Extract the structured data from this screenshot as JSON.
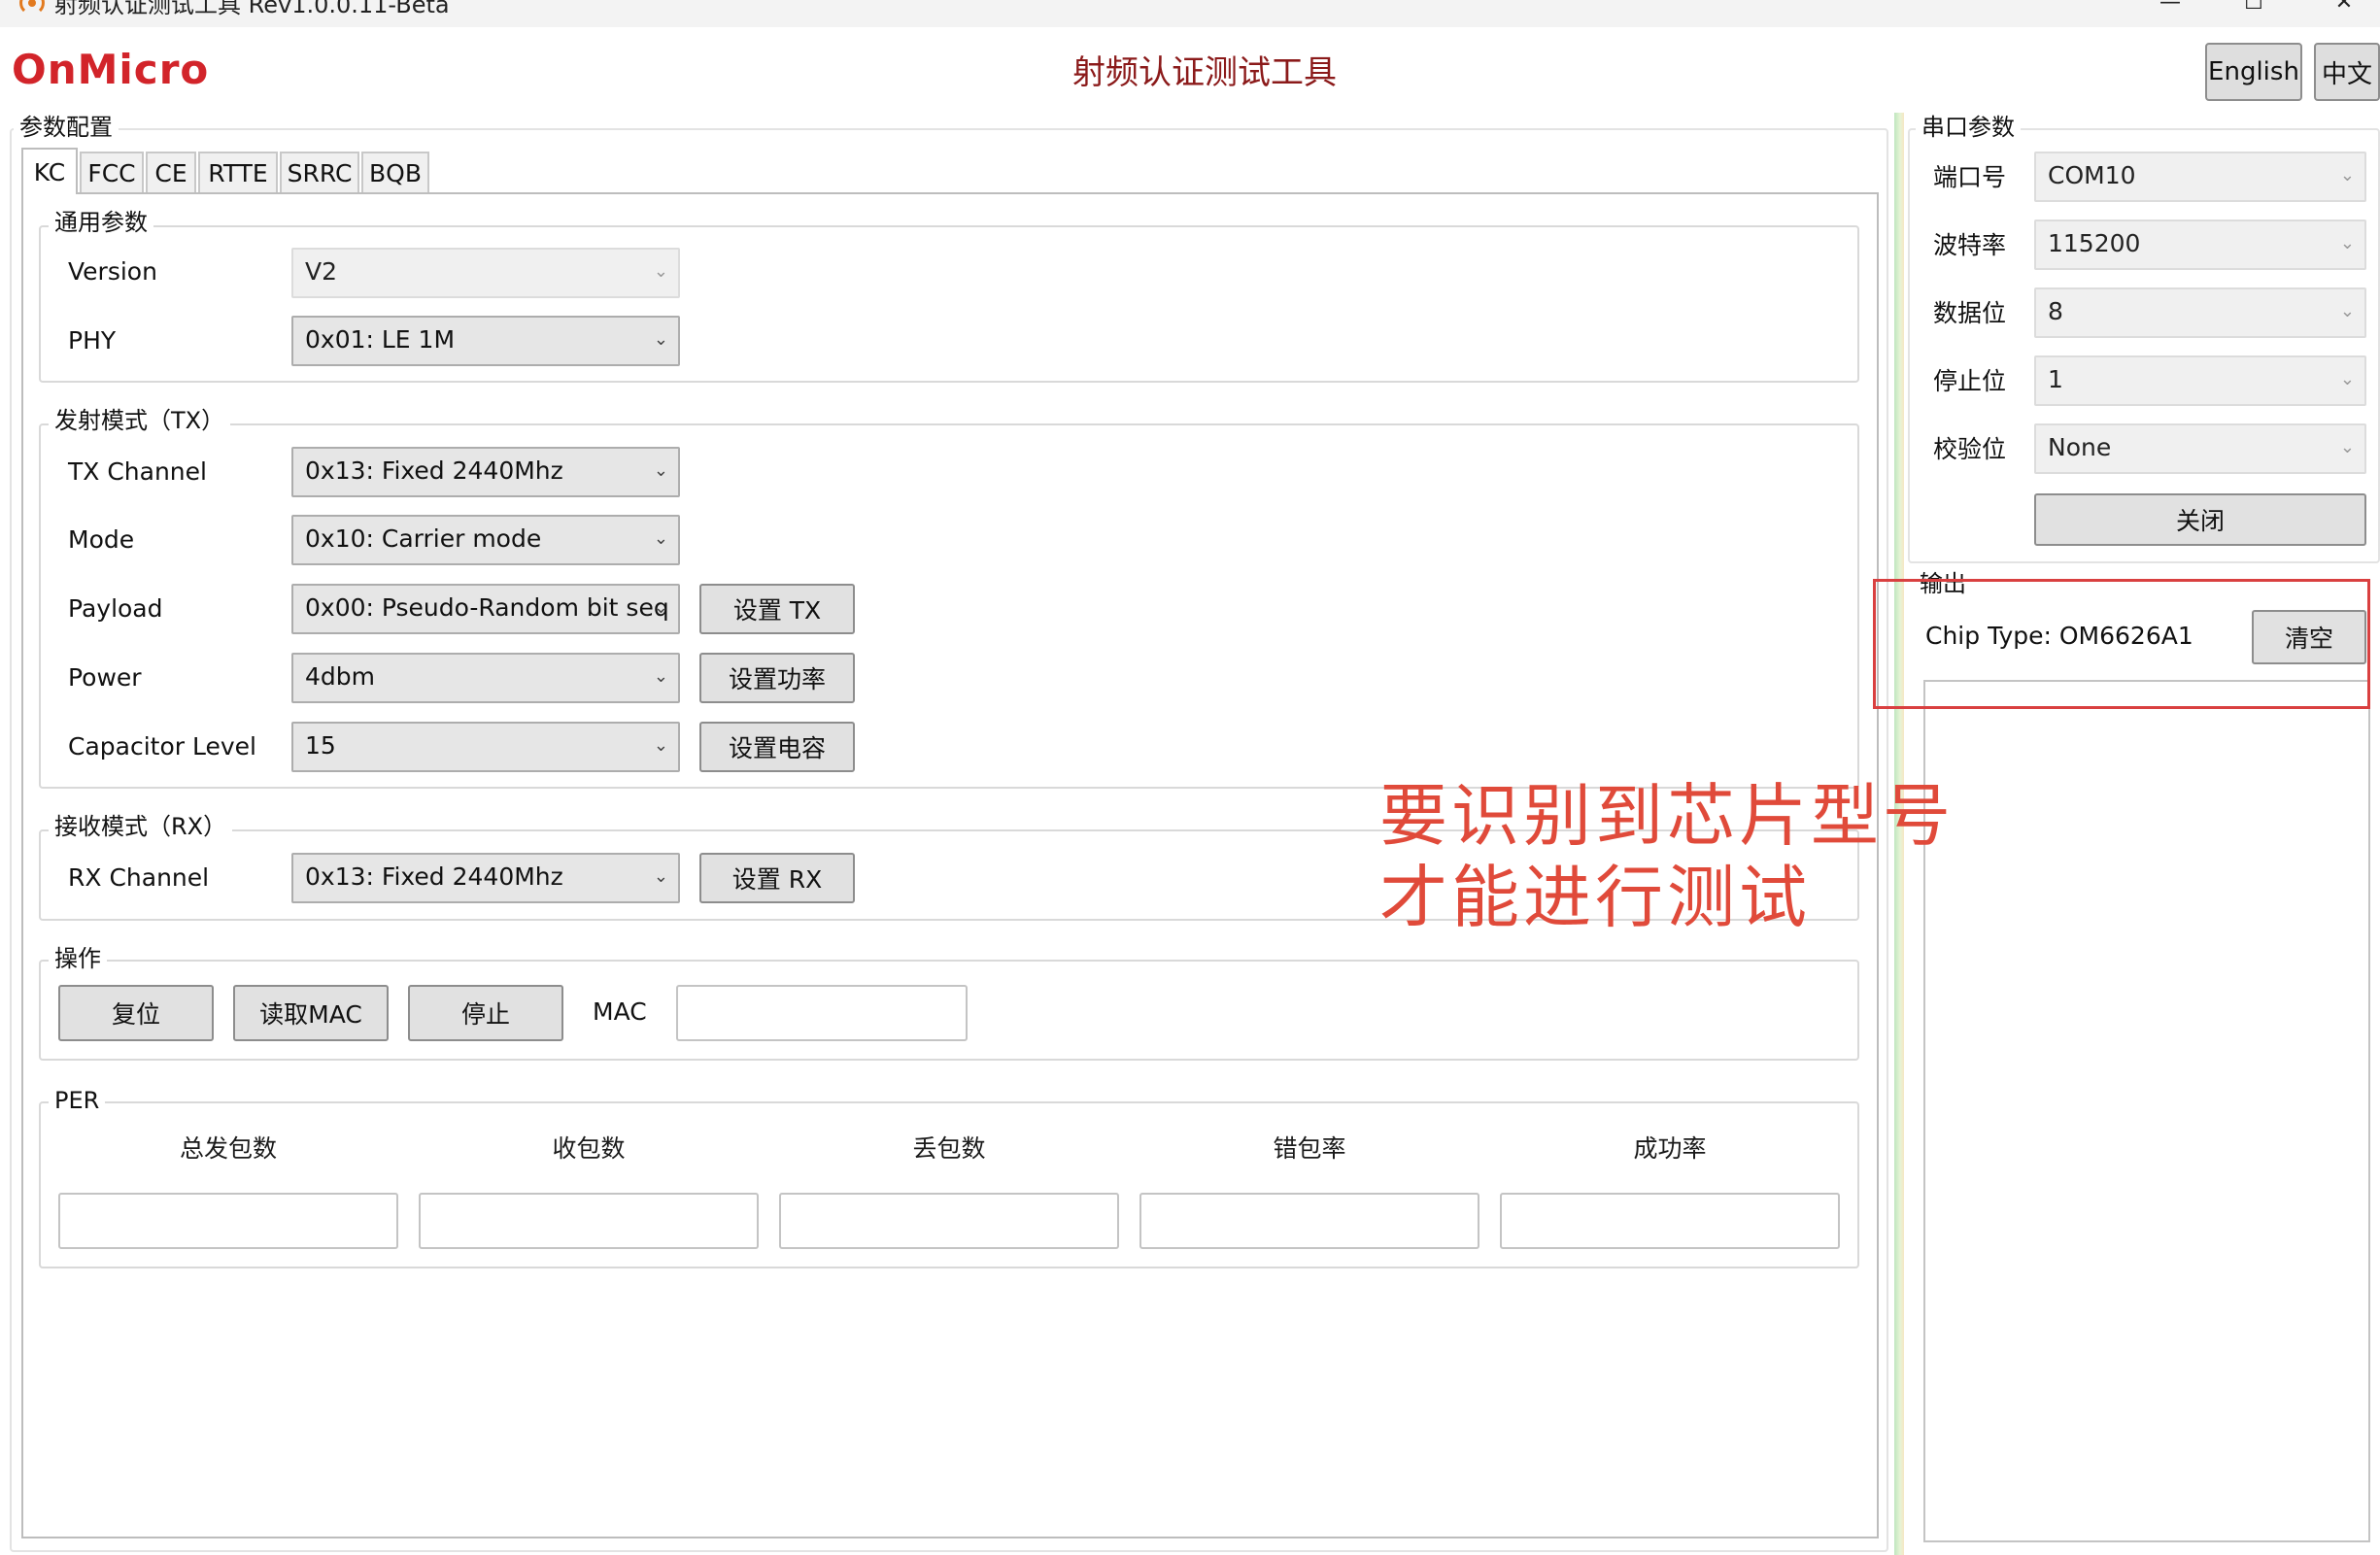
{
  "window": {
    "title": "射频认证测试工具 Rev1.0.0.11-Beta",
    "minimize_glyph": "—",
    "maximize_glyph": "☐",
    "close_glyph": "✕"
  },
  "header": {
    "logo_text": "OnMicro",
    "app_title": "射频认证测试工具",
    "lang_en": "English",
    "lang_zh": "中文",
    "brand_color": "#d2242a"
  },
  "params": {
    "group_label": "参数配置",
    "tabs": [
      {
        "label": "KC",
        "active": true
      },
      {
        "label": "FCC",
        "active": false
      },
      {
        "label": "CE",
        "active": false
      },
      {
        "label": "RTTE",
        "active": false
      },
      {
        "label": "SRRC",
        "active": false
      },
      {
        "label": "BQB",
        "active": false
      }
    ],
    "general": {
      "label": "通用参数",
      "version_label": "Version",
      "version_value": "V2",
      "phy_label": "PHY",
      "phy_value": "0x01: LE 1M"
    },
    "tx": {
      "label": "发射模式（TX）",
      "channel_label": "TX Channel",
      "channel_value": "0x13: Fixed 2440Mhz",
      "mode_label": "Mode",
      "mode_value": "0x10: Carrier mode",
      "payload_label": "Payload",
      "payload_value": "0x00: Pseudo-Random bit seq",
      "power_label": "Power",
      "power_value": "4dbm",
      "cap_label": "Capacitor Level",
      "cap_value": "15",
      "set_tx": "设置 TX",
      "set_power": "设置功率",
      "set_cap": "设置电容"
    },
    "rx": {
      "label": "接收模式（RX）",
      "channel_label": "RX Channel",
      "channel_value": "0x13: Fixed 2440Mhz",
      "set_rx": "设置 RX"
    },
    "ops": {
      "label": "操作",
      "reset": "复位",
      "read_mac": "读取MAC",
      "stop": "停止",
      "mac_label": "MAC",
      "mac_value": ""
    },
    "per": {
      "label": "PER",
      "headers": [
        "总发包数",
        "收包数",
        "丢包数",
        "错包率",
        "成功率"
      ],
      "values": [
        "",
        "",
        "",
        "",
        ""
      ]
    }
  },
  "serial": {
    "label": "串口参数",
    "port_label": "端口号",
    "port_value": "COM10",
    "baud_label": "波特率",
    "baud_value": "115200",
    "databits_label": "数据位",
    "databits_value": "8",
    "stopbits_label": "停止位",
    "stopbits_value": "1",
    "parity_label": "校验位",
    "parity_value": "None",
    "close_button": "关闭"
  },
  "output": {
    "label": "输出",
    "chip_type": "Chip Type: OM6626A1",
    "clear_button": "清空"
  },
  "annotation": {
    "line1": "要识别到芯片型号",
    "line2": "才能进行测试",
    "color": "#e04a3a"
  }
}
